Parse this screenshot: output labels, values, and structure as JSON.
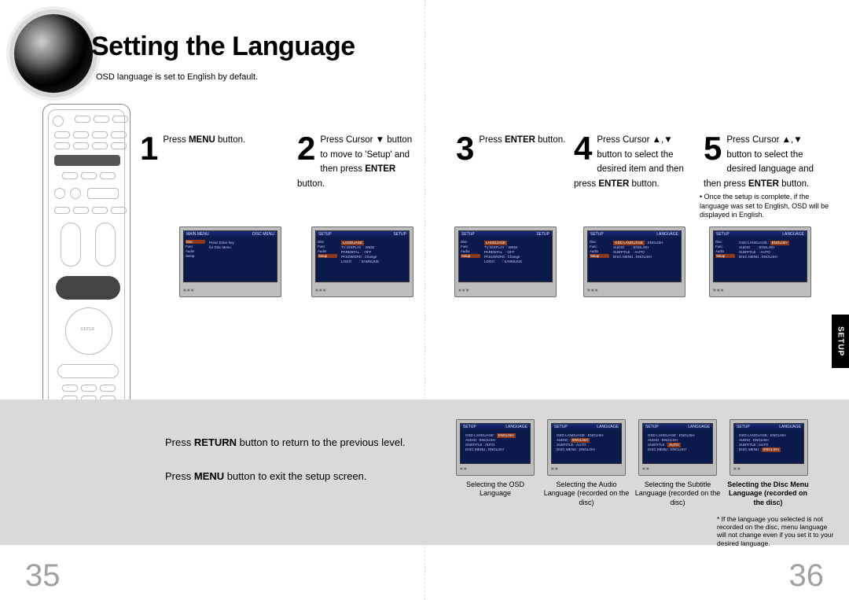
{
  "title": "Setting the Language",
  "subtitle": "OSD language is set to English by default.",
  "steps": [
    {
      "num": "1",
      "html": "Press <b>MENU</b> button."
    },
    {
      "num": "2",
      "html": "Press Cursor ▼ button to move to 'Setup' and then press <b>ENTER</b> button."
    },
    {
      "num": "3",
      "html": "Press <b>ENTER</b> button."
    },
    {
      "num": "4",
      "html": "Press Cursor ▲,▼ button to select the desired item and then press <b>ENTER</b> button."
    },
    {
      "num": "5",
      "html": "Press Cursor ▲,▼ button to select the desired language and then press <b>ENTER</b> button."
    }
  ],
  "note_complete": "Once the setup is complete, if the language was set to English, OSD will be displayed in English.",
  "return_instr_html": "Press <b>RETURN</b> button to return to the previous level.",
  "menu_instr_html": "Press <b>MENU</b> button to exit the setup screen.",
  "sel": [
    "Selecting the OSD Language",
    "Selecting the Audio Language (recorded on the disc)",
    "Selecting the Subtitle Language (recorded on the disc)",
    "Selecting the Disc Menu Language (recorded on the disc)"
  ],
  "disclaimer": "If the language you selected is not recorded on the disc, menu language will not change even if you set it to your desired language.",
  "page_left": "35",
  "page_right": "36",
  "tab": "SETUP",
  "tv": {
    "main_menu": {
      "title_l": "MAIN MENU",
      "title_r": "DISC MENU",
      "hint": "Press Enter key for Disc Menu",
      "side": [
        "Disc",
        "Func",
        "Audio",
        "Setup"
      ],
      "sel": 0
    },
    "setup": {
      "title_l": "SETUP",
      "title_r": "SETUP",
      "side": [
        "Disc",
        "Func",
        "Audio",
        "Setup"
      ],
      "sel": 3,
      "rows": [
        "LANGUAGE",
        "TV DISPLAY    : WIDE",
        "PARENTAL     : OFF",
        "PASSWORD   : Change",
        "LOGO              : SAMSUNG"
      ],
      "row_sel": 0
    },
    "language": {
      "title_l": "SETUP",
      "title_r": "LANGUAGE",
      "side": [
        "Disc",
        "Func",
        "Audio",
        "Setup"
      ],
      "sel": 3,
      "rows": [
        "OSD LANGUAGE : ENGLISH",
        "AUDIO            : ENGLISH",
        "SUBTITLE        : AUTO",
        "DISC MENU     : ENGLISH"
      ]
    },
    "lang_sub": [
      {
        "row_sel": 0
      },
      {
        "row_sel": 1
      },
      {
        "row_sel": 2
      },
      {
        "row_sel": 3
      }
    ]
  }
}
